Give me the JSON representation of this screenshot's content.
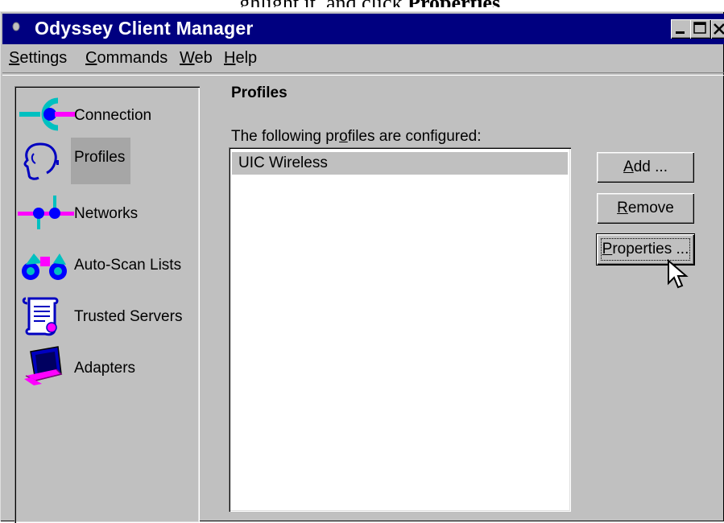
{
  "page_caption": {
    "text_prefix": "...ghlight it, and click ",
    "text_bold": "Properties"
  },
  "window": {
    "title": "Odyssey Client Manager",
    "controls": [
      "minimize",
      "maximize",
      "close"
    ]
  },
  "menu": {
    "items": [
      {
        "label": "Settings",
        "mnemonic": "S"
      },
      {
        "label": "Commands",
        "mnemonic": "C"
      },
      {
        "label": "Web",
        "mnemonic": "W"
      },
      {
        "label": "Help",
        "mnemonic": "H"
      }
    ]
  },
  "nav": {
    "items": [
      {
        "label": "Connection",
        "icon": "connection-icon",
        "selected": false
      },
      {
        "label": "Profiles",
        "icon": "profiles-head-icon",
        "selected": true
      },
      {
        "label": "Networks",
        "icon": "networks-icon",
        "selected": false
      },
      {
        "label": "Auto-Scan Lists",
        "icon": "binoculars-icon",
        "selected": false
      },
      {
        "label": "Trusted Servers",
        "icon": "scroll-certificate-icon",
        "selected": false
      },
      {
        "label": "Adapters",
        "icon": "adapter-card-icon",
        "selected": false
      }
    ]
  },
  "main": {
    "title": "Profiles",
    "list_caption": "The following profiles are configured:",
    "profiles": [
      "UIC Wireless"
    ],
    "selected_profile": "UIC Wireless"
  },
  "buttons": {
    "add": "Add ...",
    "remove": "Remove",
    "properties": "Properties ...",
    "focused": "properties"
  },
  "colors": {
    "titlebar": "#000080",
    "face": "#c0c0c0",
    "accent_blue": "#0000ff",
    "accent_magenta": "#ff00ff",
    "accent_cyan": "#00c0c0"
  }
}
